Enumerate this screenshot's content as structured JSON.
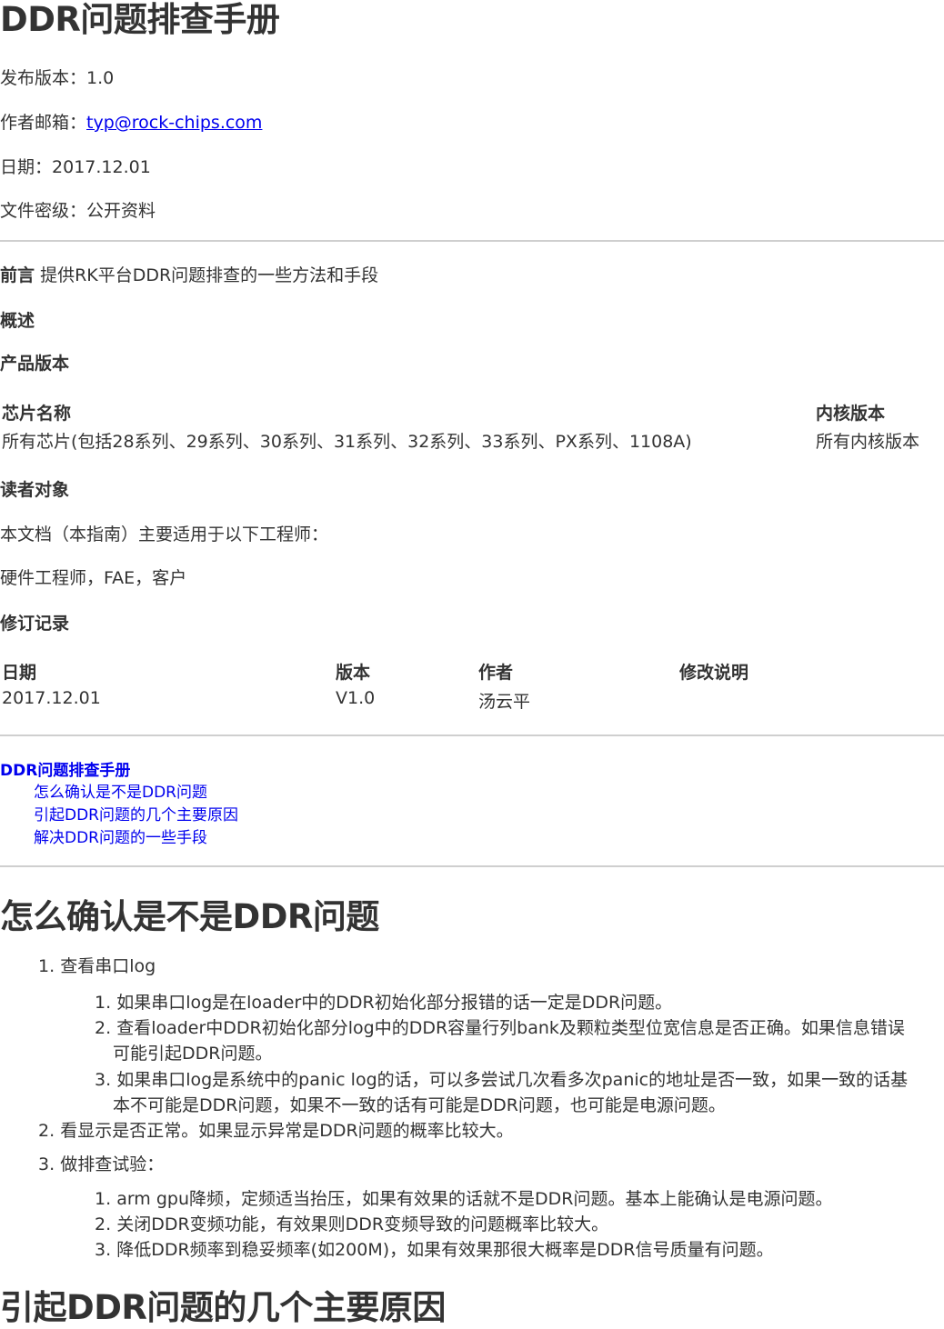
{
  "title": "DDR问题排查手册",
  "meta": {
    "version_label": "发布版本：",
    "version_value": "1.0",
    "email_label": "作者邮箱：",
    "email_value": "typ@rock-chips.com",
    "date_label": "日期：",
    "date_value": "2017.12.01",
    "security_label": "文件密级：",
    "security_value": "公开资料"
  },
  "preface": {
    "label": "前言",
    "text": "提供RK平台DDR问题排查的一些方法和手段"
  },
  "overview_heading": "概述",
  "product_version_heading": "产品版本",
  "product_table": {
    "headers": [
      "芯片名称",
      "内核版本"
    ],
    "rows": [
      [
        "所有芯片(包括28系列、29系列、30系列、31系列、32系列、33系列、PX系列、1108A)",
        "所有内核版本"
      ]
    ]
  },
  "readers": {
    "heading": "读者对象",
    "line1": "本文档（本指南）主要适用于以下工程师：",
    "line2": "硬件工程师，FAE，客户"
  },
  "revision": {
    "heading": "修订记录",
    "headers": [
      "日期",
      "版本",
      "作者",
      "修改说明"
    ],
    "rows": [
      [
        "2017.12.01",
        "V1.0",
        "汤云平",
        ""
      ]
    ]
  },
  "toc": {
    "title": "DDR问题排查手册",
    "items": [
      "怎么确认是不是DDR问题",
      "引起DDR问题的几个主要原因",
      "解决DDR问题的一些手段"
    ]
  },
  "section1": {
    "heading": "怎么确认是不是DDR问题",
    "items": [
      {
        "num": "1.",
        "text": "查看串口log",
        "sub": [
          {
            "num": "1.",
            "lines": [
              "如果串口log是在loader中的DDR初始化部分报错的话一定是DDR问题。"
            ]
          },
          {
            "num": "2.",
            "lines": [
              "查看loader中DDR初始化部分log中的DDR容量行列bank及颗粒类型位宽信息是否正确。如果信息错误",
              "可能引起DDR问题。"
            ]
          },
          {
            "num": "3.",
            "lines": [
              "如果串口log是系统中的panic log的话，可以多尝试几次看多次panic的地址是否一致，如果一致的话基",
              "本不可能是DDR问题，如果不一致的话有可能是DDR问题，也可能是电源问题。"
            ]
          }
        ]
      },
      {
        "num": "2.",
        "text": "看显示是否正常。如果显示异常是DDR问题的概率比较大。"
      },
      {
        "num": "3.",
        "text": "做排查试验：",
        "sub": [
          {
            "num": "1.",
            "lines": [
              "arm gpu降频，定频适当抬压，如果有效果的话就不是DDR问题。基本上能确认是电源问题。"
            ]
          },
          {
            "num": "2.",
            "lines": [
              "关闭DDR变频功能，有效果则DDR变频导致的问题概率比较大。"
            ]
          },
          {
            "num": "3.",
            "lines": [
              "降低DDR频率到稳妥频率(如200M)，如果有效果那很大概率是DDR信号质量有问题。"
            ]
          }
        ]
      }
    ]
  },
  "section2": {
    "heading": "引起DDR问题的几个主要原因"
  }
}
